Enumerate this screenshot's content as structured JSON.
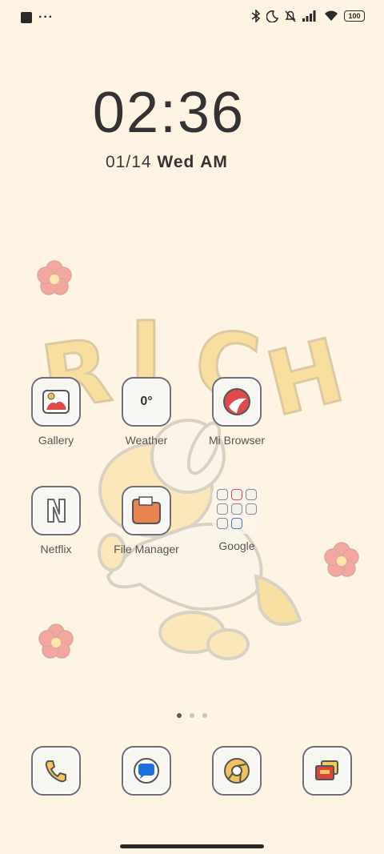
{
  "status_bar": {
    "left_icons": [
      "app-square-icon",
      "more-dots-icon"
    ],
    "right_icons": [
      "bluetooth-icon",
      "do-not-disturb-moon-icon",
      "mute-bell-icon",
      "cellular-signal-icon",
      "wifi-icon"
    ],
    "battery": "100"
  },
  "lockscreen": {
    "time": "02:36",
    "date": "01/14",
    "weekday": "Wed",
    "ampm": "AM"
  },
  "wallpaper": {
    "text": "RICH",
    "colors": {
      "background": "#fdf4e3",
      "letters": "#f8dfa0",
      "flower": "#f4a7a0"
    }
  },
  "apps": [
    {
      "label": "Gallery",
      "icon": "gallery-icon"
    },
    {
      "label": "Weather",
      "icon": "weather-icon",
      "badge": "0°"
    },
    {
      "label": "Mi Browser",
      "icon": "browser-icon"
    },
    {
      "label": "Netflix",
      "icon": "netflix-icon"
    },
    {
      "label": "File Manager",
      "icon": "folder-icon"
    },
    {
      "label": "Google",
      "icon": "google-folder-icon"
    }
  ],
  "page_indicator": {
    "count": 3,
    "active": 1
  },
  "dock": [
    {
      "icon": "phone-icon"
    },
    {
      "icon": "messages-icon"
    },
    {
      "icon": "chrome-icon"
    },
    {
      "icon": "theme-store-icon"
    }
  ]
}
